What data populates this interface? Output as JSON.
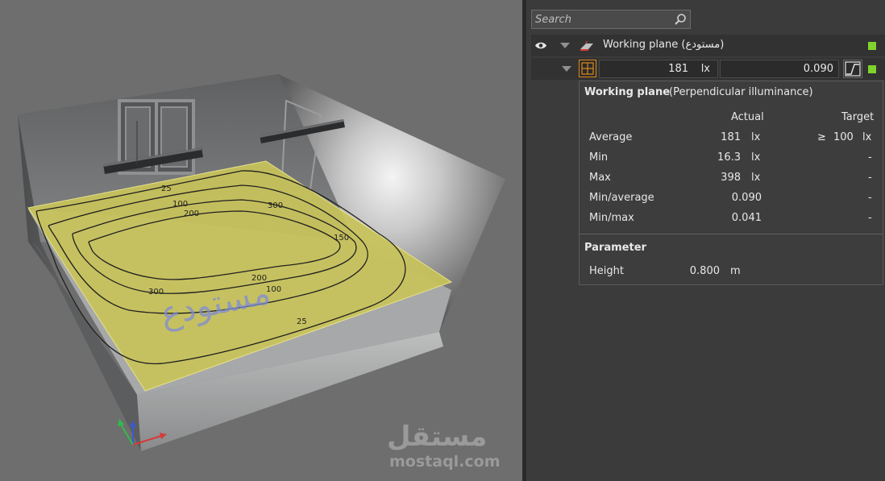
{
  "colors": {
    "accent": "#e08a1a",
    "status_ok": "#7fd32c",
    "plane_fill": "#c9c35a"
  },
  "viewport": {
    "isolines": [
      {
        "label": "25"
      },
      {
        "label": "100"
      },
      {
        "label": "200"
      },
      {
        "label": "300"
      },
      {
        "label": "300"
      },
      {
        "label": "200"
      },
      {
        "label": "100"
      },
      {
        "label": "150"
      },
      {
        "label": "25"
      }
    ],
    "watermark_text": "مستودع",
    "logo_text": "مستقل",
    "logo_url": "mostaql.com"
  },
  "panel": {
    "search": {
      "placeholder": "Search"
    },
    "object": {
      "name": "Working plane (مستودع)"
    },
    "summary": {
      "average": "181",
      "unit": "lx",
      "uniformity": "0.090"
    },
    "popup": {
      "title_bold": "Working plane",
      "title_rest": "(Perpendicular illuminance)",
      "col_actual": "Actual",
      "col_target": "Target",
      "rows": [
        {
          "label": "Average",
          "actual": "181",
          "actual_unit": "lx",
          "target_op": "≥",
          "target": "100",
          "target_unit": "lx"
        },
        {
          "label": "Min",
          "actual": "16.3",
          "actual_unit": "lx",
          "target": "-"
        },
        {
          "label": "Max",
          "actual": "398",
          "actual_unit": "lx",
          "target": "-"
        },
        {
          "label": "Min/average",
          "actual": "0.090",
          "target": "-"
        },
        {
          "label": "Min/max",
          "actual": "0.041",
          "target": "-"
        }
      ],
      "param_title": "Parameter",
      "param_label": "Height",
      "param_value": "0.800",
      "param_unit": "m"
    }
  }
}
